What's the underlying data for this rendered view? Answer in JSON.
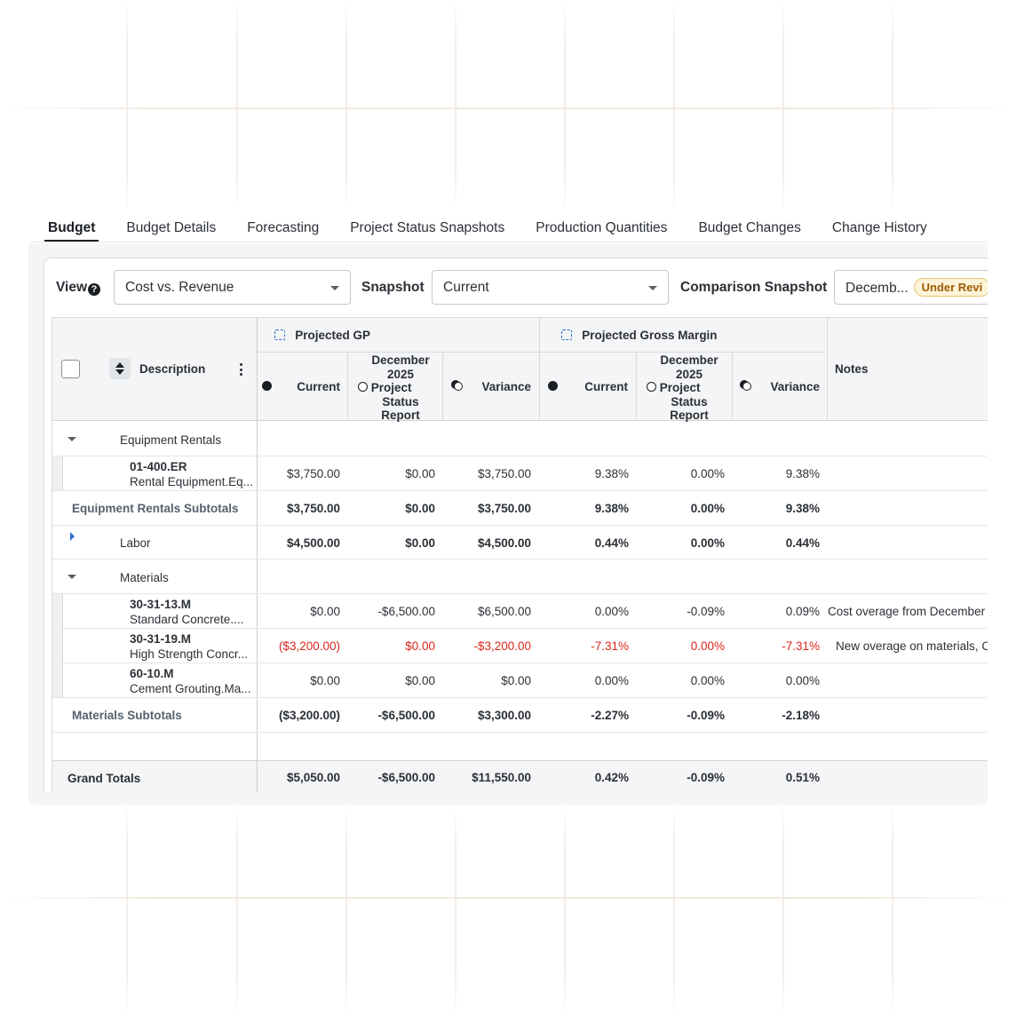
{
  "tabs": [
    "Budget",
    "Budget Details",
    "Forecasting",
    "Project Status Snapshots",
    "Production Quantities",
    "Budget Changes",
    "Change History"
  ],
  "filters": {
    "view_label": "View",
    "view_value": "Cost vs. Revenue",
    "snapshot_label": "Snapshot",
    "snapshot_value": "Current",
    "comparison_label": "Comparison Snapshot",
    "comparison_value": "Decemb...",
    "comparison_badge": "Under Revi"
  },
  "header": {
    "description": "Description",
    "group_gp": "Projected GP",
    "group_margin": "Projected Gross Margin",
    "current": "Current",
    "snapshot_line1": "December",
    "snapshot_line2": "2025",
    "snapshot_line3": "Project",
    "snapshot_line4": "Status",
    "snapshot_line5": "Report",
    "variance": "Variance",
    "notes": "Notes"
  },
  "rows": {
    "equip_group": "Equipment Rentals",
    "er_code": "01-400.ER",
    "er_desc": "Rental Equipment.Eq...",
    "er_vals": [
      "$3,750.00",
      "$0.00",
      "$3,750.00",
      "9.38%",
      "0.00%",
      "9.38%"
    ],
    "equip_sub_label": "Equipment Rentals Subtotals",
    "equip_sub": [
      "$3,750.00",
      "$0.00",
      "$3,750.00",
      "9.38%",
      "0.00%",
      "9.38%"
    ],
    "labor_group": "Labor",
    "labor_vals": [
      "$4,500.00",
      "$0.00",
      "$4,500.00",
      "0.44%",
      "0.00%",
      "0.44%"
    ],
    "mat_group": "Materials",
    "m1_code": "30-31-13.M",
    "m1_desc": "Standard Concrete....",
    "m1_vals": [
      "$0.00",
      "-$6,500.00",
      "$6,500.00",
      "0.00%",
      "-0.09%",
      "0.09%"
    ],
    "m1_note": "Cost overage from December",
    "m2_code": "30-31-19.M",
    "m2_desc": "High Strength Concr...",
    "m2_vals": [
      "($3,200.00)",
      "$0.00",
      "-$3,200.00",
      "-7.31%",
      "0.00%",
      "-7.31%"
    ],
    "m2_note": "New overage on materials, C",
    "m3_code": "60-10.M",
    "m3_desc": "Cement Grouting.Ma...",
    "m3_vals": [
      "$0.00",
      "$0.00",
      "$0.00",
      "0.00%",
      "0.00%",
      "0.00%"
    ],
    "mat_sub_label": "Materials Subtotals",
    "mat_sub": [
      "($3,200.00)",
      "-$6,500.00",
      "$3,300.00",
      "-2.27%",
      "-0.09%",
      "-2.18%"
    ],
    "grand_label": "Grand Totals",
    "grand": [
      "$5,050.00",
      "-$6,500.00",
      "$11,550.00",
      "0.42%",
      "-0.09%",
      "0.51%"
    ]
  },
  "colors": {
    "negative": "#d9251c",
    "accent": "#2f6fd0",
    "badge_text": "#a05c00",
    "badge_bg": "#fdf3d8"
  }
}
